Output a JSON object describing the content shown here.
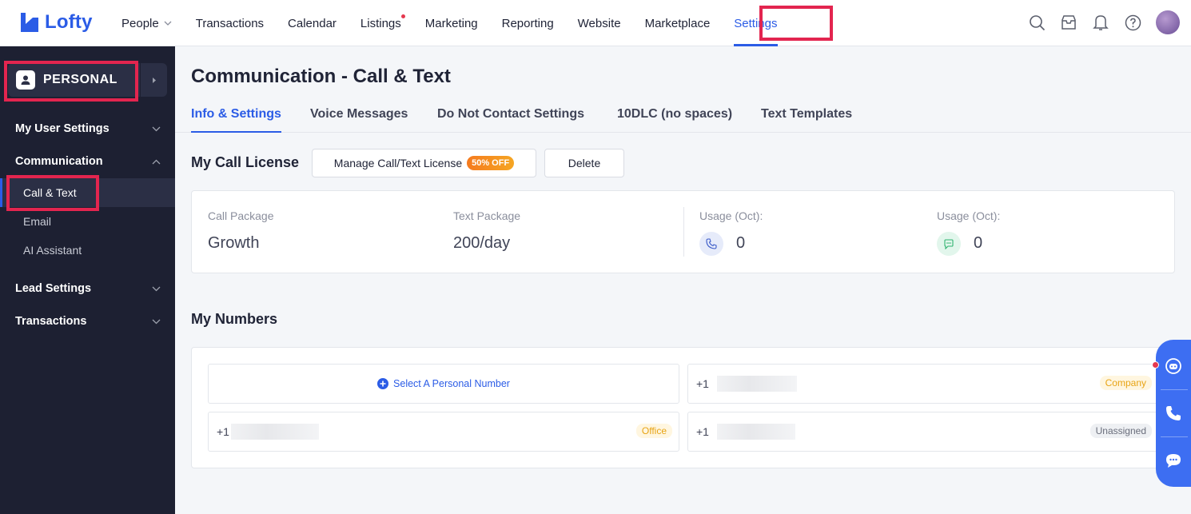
{
  "app": {
    "logo_text": "Lofty",
    "brand_color": "#2b5ce6",
    "highlight_color": "#e3254f"
  },
  "nav": {
    "items": [
      {
        "label": "People",
        "has_dropdown": true
      },
      {
        "label": "Transactions"
      },
      {
        "label": "Calendar"
      },
      {
        "label": "Listings",
        "has_dot": true
      },
      {
        "label": "Marketing"
      },
      {
        "label": "Reporting"
      },
      {
        "label": "Website"
      },
      {
        "label": "Marketplace"
      },
      {
        "label": "Settings",
        "active": true
      }
    ],
    "icons": [
      "search-icon",
      "inbox-icon",
      "bell-icon",
      "help-icon",
      "avatar"
    ]
  },
  "sidebar": {
    "persona_label": "PERSONAL",
    "groups": [
      {
        "label": "My User Settings",
        "expanded": false
      },
      {
        "label": "Communication",
        "expanded": true,
        "items": [
          "Call & Text",
          "Email",
          "AI Assistant"
        ],
        "active_item": "Call & Text"
      },
      {
        "label": "Lead Settings",
        "expanded": false
      },
      {
        "label": "Transactions",
        "expanded": false
      }
    ]
  },
  "main": {
    "title": "Communication - Call & Text",
    "tabs": [
      {
        "label": "Info & Settings",
        "active": true
      },
      {
        "label": "Voice Messages"
      },
      {
        "label": "Do Not Contact Settings"
      },
      {
        "label": "10DLC (no spaces)"
      },
      {
        "label": "Text Templates"
      }
    ],
    "license": {
      "title": "My Call License",
      "manage_label": "Manage Call/Text License",
      "badge": "50% OFF",
      "delete_label": "Delete",
      "call_package_label": "Call Package",
      "call_package_value": "Growth",
      "text_package_label": "Text Package",
      "text_package_value": "200/day",
      "call_usage_label": "Usage (Oct):",
      "call_usage_value": "0",
      "text_usage_label": "Usage (Oct):",
      "text_usage_value": "0"
    },
    "numbers": {
      "title": "My Numbers",
      "select_label": "Select A Personal Number",
      "entries": [
        {
          "prefix": "+1",
          "tag": "Company"
        },
        {
          "prefix": "+1",
          "tag": "Office"
        },
        {
          "prefix": "+1",
          "tag": "Unassigned"
        }
      ]
    }
  },
  "dock": {
    "icons": [
      "assistant-icon",
      "phone-icon",
      "chat-icon"
    ]
  }
}
